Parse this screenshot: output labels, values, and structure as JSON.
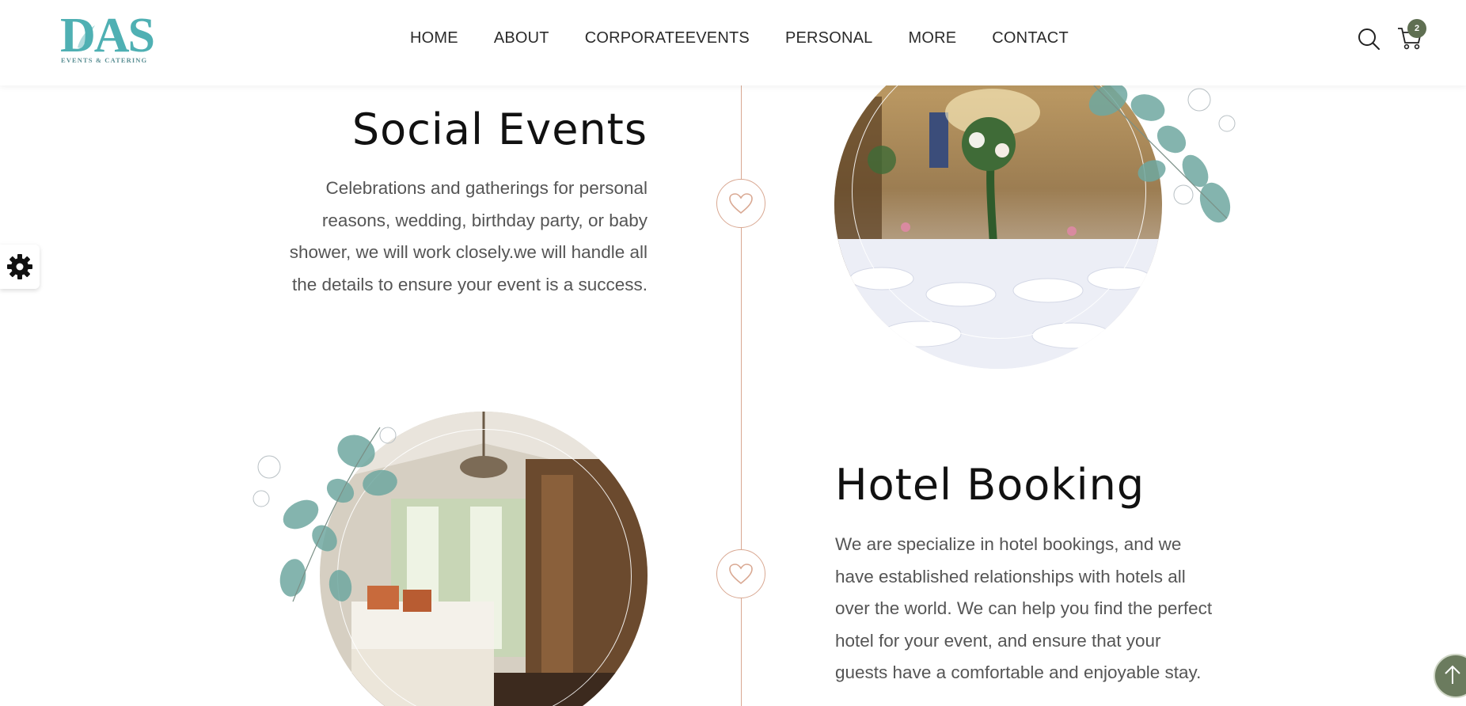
{
  "brand": {
    "logo_letters": "DAS",
    "logo_tagline": "EVENTS & CATERING",
    "colors": {
      "teal": "#4fb0b3",
      "timeline": "#d9a892",
      "badge": "#5f6f52"
    }
  },
  "nav": {
    "items": [
      "HOME",
      "ABOUT",
      "CORPORATEEVENTS",
      "PERSONAL",
      "MORE",
      "CONTACT"
    ]
  },
  "header_icons": {
    "search": "search-icon",
    "cart": "cart-icon",
    "cart_count": "2"
  },
  "sections": [
    {
      "title": "Social Events",
      "lines": [
        "Celebrations and gatherings for personal",
        "reasons, wedding, birthday party, or baby",
        "shower, we will work closely.we will handle all",
        "the details to ensure your event is a success."
      ],
      "image": "banquet-hall-photo",
      "node_icon": "heart-icon"
    },
    {
      "title": "Hotel Booking",
      "lines": [
        "We are specialize in hotel bookings, and we",
        "have established relationships with hotels all",
        "over the world. We can help you find the perfect",
        "hotel for your event, and ensure that your",
        "guests have a comfortable and enjoyable stay."
      ],
      "image": "hotel-room-photo",
      "node_icon": "heart-icon"
    }
  ],
  "floating": {
    "settings": "gear-icon",
    "scroll_top": "arrow-up-icon"
  }
}
